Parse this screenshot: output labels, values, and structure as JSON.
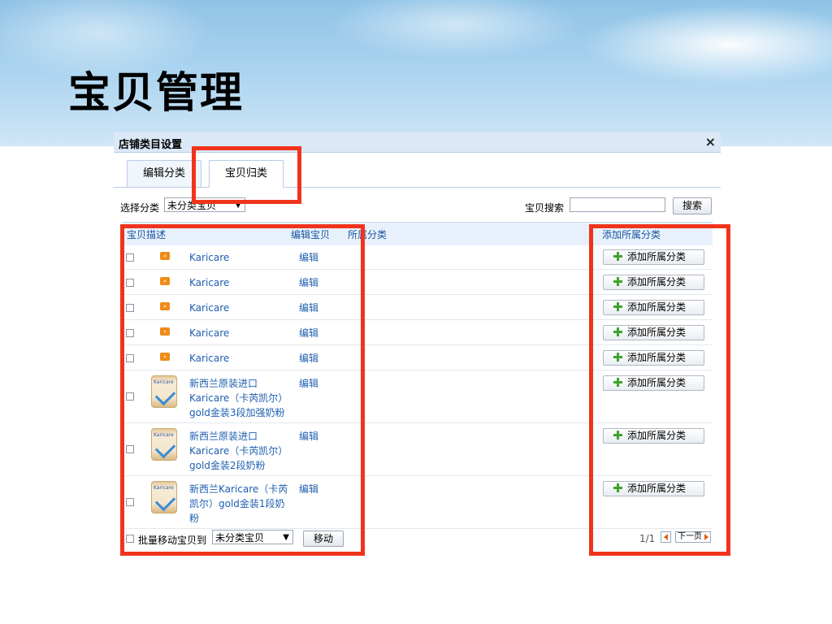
{
  "slide": {
    "title": "宝贝管理"
  },
  "dialog": {
    "title": "店铺类目设置",
    "close_icon": "×",
    "tabs": [
      {
        "label": "编辑分类",
        "active": false
      },
      {
        "label": "宝贝归类",
        "active": true
      }
    ],
    "filter": {
      "label": "选择分类",
      "selected": "未分类宝贝"
    },
    "search": {
      "label": "宝贝搜索",
      "value": "",
      "button": "搜索"
    },
    "columns": {
      "desc": "宝贝描述",
      "edit": "编辑宝贝",
      "category": "所属分类",
      "add": "添加所属分类"
    },
    "rows": [
      {
        "name": "Karicare",
        "thumb": "camera-icon",
        "edit": "编辑",
        "add": "添加所属分类"
      },
      {
        "name": "Karicare",
        "thumb": "camera-icon",
        "edit": "编辑",
        "add": "添加所属分类"
      },
      {
        "name": "Karicare",
        "thumb": "camera-icon",
        "edit": "编辑",
        "add": "添加所属分类"
      },
      {
        "name": "Karicare",
        "thumb": "camera-icon",
        "edit": "编辑",
        "add": "添加所属分类"
      },
      {
        "name": "Karicare",
        "thumb": "camera-icon",
        "edit": "编辑",
        "add": "添加所属分类"
      },
      {
        "name": "新西兰原装进口Karicare（卡芮凯尔）gold金装3段加强奶粉",
        "thumb": "formula-can-image",
        "edit": "编辑",
        "add": "添加所属分类"
      },
      {
        "name": "新西兰原装进口Karicare（卡芮凯尔）gold金装2段奶粉",
        "thumb": "formula-can-image",
        "edit": "编辑",
        "add": "添加所属分类"
      },
      {
        "name": "新西兰Karicare（卡芮凯尔）gold金装1段奶粉",
        "thumb": "formula-can-image",
        "edit": "编辑",
        "add": "添加所属分类"
      }
    ],
    "footer": {
      "batch_label": "批量移动宝贝到",
      "batch_select": "未分类宝贝",
      "move_button": "移动",
      "page_info": "1/1",
      "next_label": "下一页"
    }
  },
  "colors": {
    "highlight": "#f0341c",
    "link": "#1f5fb0",
    "header_bg": "#dbe8f7"
  }
}
